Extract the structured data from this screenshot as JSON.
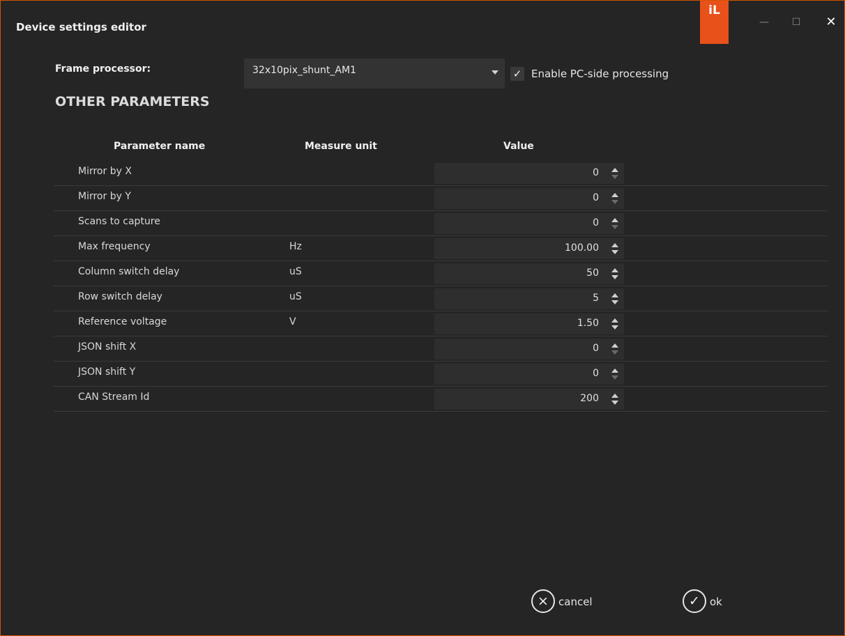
{
  "window": {
    "title": "Device settings editor",
    "brand": "iL",
    "minimize_glyph": "—",
    "maximize_glyph": "☐",
    "close_glyph": "✕",
    "accent_color": "#e8511a"
  },
  "frame_processor": {
    "label": "Frame processor:",
    "selected": "32x10pix_shunt_AM1",
    "enable_pc_processing": {
      "label": "Enable PC-side processing",
      "checked": true
    }
  },
  "section_title": "OTHER PARAMETERS",
  "table": {
    "headers": [
      "Parameter name",
      "Measure unit",
      "Value"
    ],
    "rows": [
      {
        "name": "Mirror by X",
        "unit": "",
        "value": "0"
      },
      {
        "name": "Mirror by Y",
        "unit": "",
        "value": "0"
      },
      {
        "name": "Scans to capture",
        "unit": "",
        "value": "0"
      },
      {
        "name": "Max frequency",
        "unit": "Hz",
        "value": "100.00"
      },
      {
        "name": "Column switch delay",
        "unit": "uS",
        "value": "50"
      },
      {
        "name": "Row switch delay",
        "unit": "uS",
        "value": "5"
      },
      {
        "name": "Reference voltage",
        "unit": "V",
        "value": "1.50"
      },
      {
        "name": "JSON shift X",
        "unit": "",
        "value": "0"
      },
      {
        "name": "JSON shift Y",
        "unit": "",
        "value": "0"
      },
      {
        "name": "CAN Stream Id",
        "unit": "",
        "value": "200"
      }
    ]
  },
  "footer": {
    "cancel_label": "cancel",
    "cancel_icon": "⨯",
    "ok_label": "ok",
    "ok_icon": "✓"
  }
}
